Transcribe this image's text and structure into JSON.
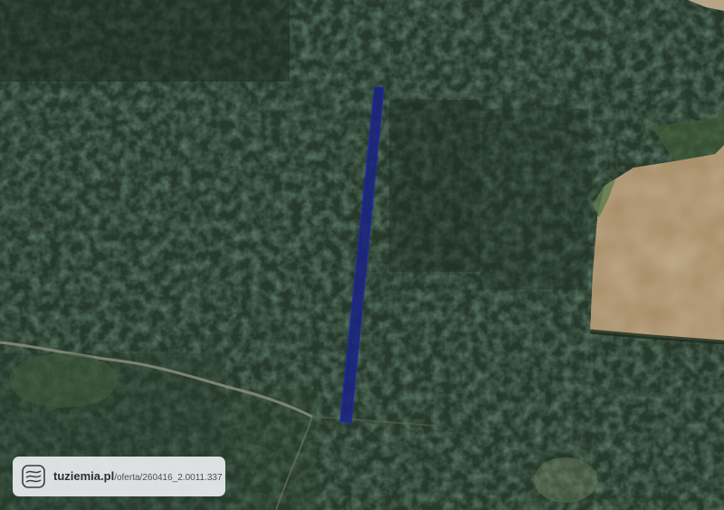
{
  "map": {
    "type": "satellite",
    "land_cover": [
      "forest",
      "cultivated-field",
      "dirt-road"
    ],
    "parcel": {
      "shape": "long-narrow-strip",
      "orientation": "north-south",
      "fill_color": "#1a237e",
      "stroke_color": "#1c2aa8"
    },
    "colors": {
      "forest": "#26392b",
      "field": "#a88f6a",
      "road": "#8a8f80"
    }
  },
  "watermark": {
    "domain": "tuziemia.pl",
    "path": "/oferta/260416_2.0011.337",
    "logo_icon": "contour-lines-icon"
  }
}
